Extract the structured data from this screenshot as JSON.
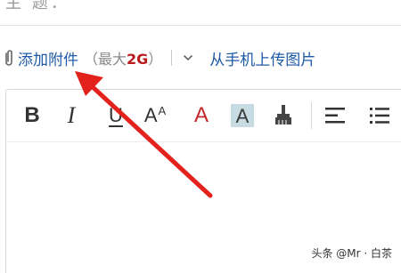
{
  "subject": {
    "label": "主  题："
  },
  "attachment": {
    "link_label": "添加附件",
    "note_prefix": "（最大",
    "size": "2G",
    "note_suffix": "）",
    "mobile_upload_label": "从手机上传图片"
  },
  "toolbar": {
    "bold": "B",
    "italic": "I",
    "underline": "U",
    "font_size_big": "A",
    "font_size_small": "A",
    "font_color": "A",
    "bg_color": "A"
  },
  "watermark": "头条 @Mr · 白茶",
  "colors": {
    "link": "#1f5aa6",
    "size_highlight": "#b81b1b",
    "font_color_icon": "#c0282b",
    "bg_color_swatch": "#c7dbe3",
    "annotation_arrow": "#e3211d"
  },
  "icons": [
    "paperclip-icon",
    "dropdown-chevron-icon",
    "brush-icon",
    "align-left-icon",
    "bullet-list-icon"
  ]
}
